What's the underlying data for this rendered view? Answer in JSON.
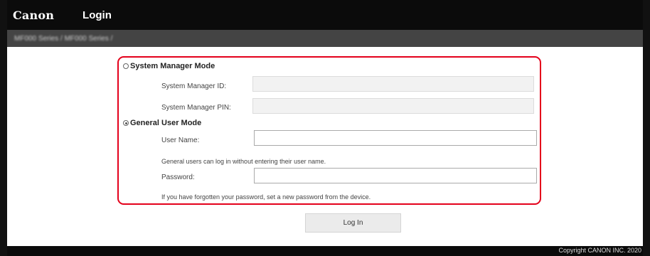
{
  "header": {
    "logo": "Canon",
    "title": "Login"
  },
  "subbar": {
    "device_name": "MF000 Series / MF000 Series /"
  },
  "login": {
    "system_manager_mode": {
      "label": "System Manager Mode",
      "selected": false,
      "id_label": "System Manager ID:",
      "id_value": "",
      "pin_label": "System Manager PIN:",
      "pin_value": ""
    },
    "general_user_mode": {
      "label": "General User Mode",
      "selected": true,
      "user_name_label": "User Name:",
      "user_name_value": "",
      "user_name_hint": "General users can log in without entering their user name.",
      "password_label": "Password:",
      "password_value": "",
      "password_hint": "If you have forgotten your password, set a new password from the device."
    },
    "submit_label": "Log In",
    "highlight_color": "#e4001b"
  },
  "footer": {
    "copyright": "Copyright CANON INC. 2020"
  }
}
